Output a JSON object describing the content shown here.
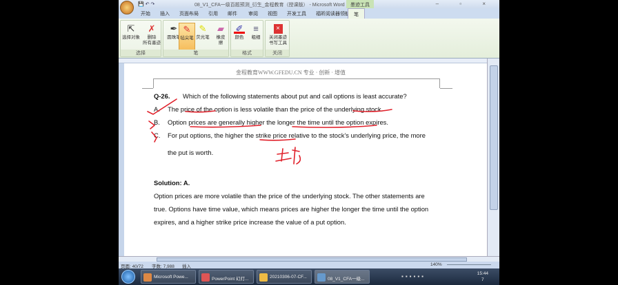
{
  "window": {
    "title": "08_V1_CFA一级百题预测_衍生_金程教育（授课版） - Microsoft Word",
    "context_tab": "墨迹工具",
    "quick_access": "💾 ↶ ↷",
    "window_buttons": "– ▫ ×"
  },
  "tabs": [
    "开始",
    "插入",
    "页面布局",
    "引用",
    "邮件",
    "审阅",
    "视图",
    "开发工具",
    "福昕阅读器领航版",
    "笔"
  ],
  "ribbon": {
    "groups": [
      {
        "label": "选择",
        "buttons": [
          "选择对象",
          "删除\n所有墨迹"
        ]
      },
      {
        "label": "笔",
        "buttons": [
          "圆珠笔",
          "毡尖笔",
          "荧光笔",
          "橡皮\n擦"
        ]
      },
      {
        "label": "格式",
        "buttons": [
          "颜色",
          "粗细"
        ]
      },
      {
        "label": "关闭",
        "buttons": [
          "关闭墨迹\n书写工具"
        ]
      }
    ]
  },
  "document": {
    "header": "金程教育WWW.GFEDU.CN 专业 · 创新 · 增值",
    "question_number": "Q-26.",
    "question": "Which of the following statements about put and call options is least accurate?",
    "options": [
      {
        "letter": "A.",
        "text": "The price of the option is less volatile than the price of the underlying stock."
      },
      {
        "letter": "B.",
        "text": "Option prices are generally higher the longer the time until the option expires."
      },
      {
        "letter": "C.",
        "text": "For put options, the higher the strike price relative to the stock’s underlying price, the more",
        "text2": "the put is worth."
      }
    ],
    "solution_label": "Solution: A.",
    "solution_lines": [
      "Option prices are more volatile than the price of the underlying stock. The other statements are",
      "true. Options have time value, which means prices are higher the longer the time until the option",
      "expires, and a higher strike price increase the value of a put option."
    ],
    "ink_color": "#e0202a"
  },
  "status": {
    "page": "页面: 40/72",
    "words": "字数: 7,988",
    "mode": "插入",
    "zoom": "140%"
  },
  "taskbar": {
    "items": [
      "Microsoft Powe...",
      "PowerPoint 幻灯...",
      "20210306-07-CF...",
      "08_V1_CFA一级..."
    ],
    "time": "15:44",
    "date": "7"
  }
}
